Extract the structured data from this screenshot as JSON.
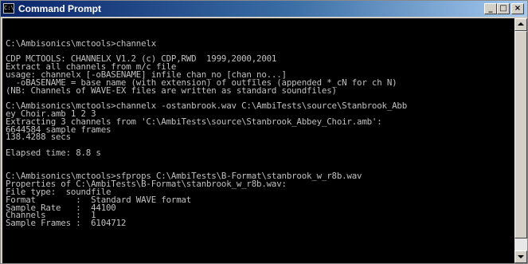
{
  "window": {
    "title": "Command Prompt",
    "icon_label": "C:\\",
    "minimize_glyph": "_",
    "maximize_glyph": "□",
    "close_glyph": "×"
  },
  "console": {
    "lines": [
      "",
      "C:\\Ambisonics\\mctools>channelx",
      "",
      "CDP MCTOOLS: CHANNELX V1.2 (c) CDP,RWD  1999,2000,2001",
      "Extract all channels from m/c file",
      "usage: channelx [-oBASENAME] infile chan_no [chan_no...]",
      "  -oBASENAME = base name (with extension) of outfiles (appended *_cN for ch N)",
      "(NB: Channels of WAVE-EX files are written as standard soundfiles)",
      "",
      "C:\\Ambisonics\\mctools>channelx -ostanbrook.wav C:\\AmbiTests\\source\\Stanbrook_Abb",
      "ey_Choir.amb 1 2 3",
      "Extracting 3 channels from 'C:\\AmbiTests\\source\\Stanbrook_Abbey_Choir.amb':",
      "6644584 sample frames",
      "138.4288 secs",
      "",
      "Elapsed time: 8.8 s",
      "",
      "",
      "C:\\Ambisonics\\mctools>sfprops C:\\AmbiTests\\B-Format\\stanbrook_w_r8b.wav",
      "Properties of C:\\AmbiTests\\B-Format\\stanbrook_w_r8b.wav:",
      "File type:  soundfile",
      "Format        :  Standard WAVE format",
      "Sample Rate   :  44100",
      "Channels      :  1",
      "Sample Frames :  6104712"
    ]
  },
  "colors": {
    "console_bg": "#000000",
    "console_fg": "#c0c0c0",
    "titlebar_start": "#0a246a",
    "titlebar_end": "#a6caf0"
  }
}
